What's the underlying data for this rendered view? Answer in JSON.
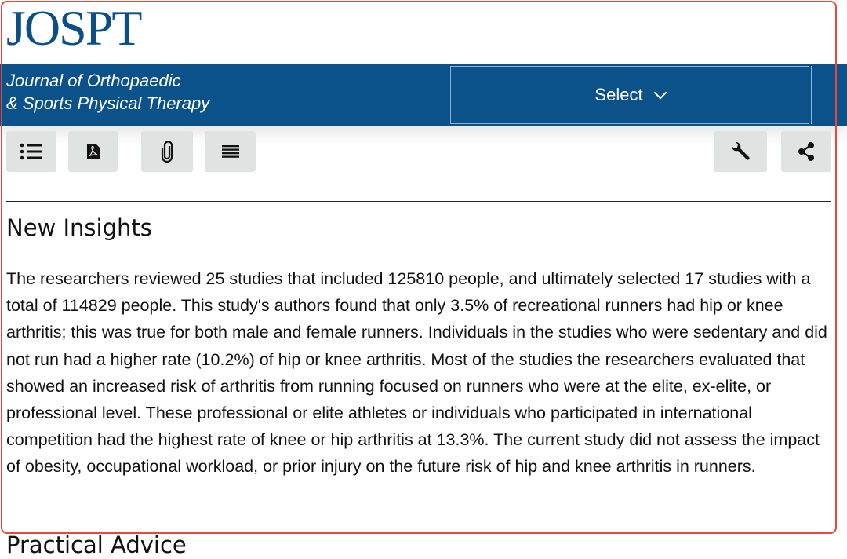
{
  "header": {
    "logo": "JOSPT",
    "brand_line1": "Journal of Orthopaedic",
    "brand_line2": "& Sports Physical Therapy",
    "select_label": "Select"
  },
  "toolbar": {
    "icons": [
      "list-icon",
      "pdf-icon",
      "paperclip-icon",
      "text-lines-icon",
      "wrench-icon",
      "share-icon"
    ]
  },
  "article": {
    "section_title": "New Insights",
    "paragraph": "The researchers reviewed 25 studies that included 125810 people, and ultimately selected 17 studies with a total of 114829 people. This study's authors found that only 3.5% of recreational runners had hip or knee arthritis; this was true for both male and female runners. Individuals in the studies who were sedentary and did not run had a higher rate (10.2%) of hip or knee arthritis. Most of the studies the researchers evaluated that showed an increased risk of arthritis from running focused on runners who were at the elite, ex-elite, or professional level. These professional or elite athletes or individuals who participated in international competition had the highest rate of knee or hip arthritis at 13.3%. The current study did not assess the impact of obesity, occupational workload, or prior injury on the future risk of hip and knee arthritis in runners.",
    "next_section_title": "Practical Advice"
  },
  "colors": {
    "brand_blue": "#0a5289",
    "logo_blue": "#0b4f86",
    "highlight_border": "#e8473a",
    "tool_bg": "#dfe4e3"
  }
}
